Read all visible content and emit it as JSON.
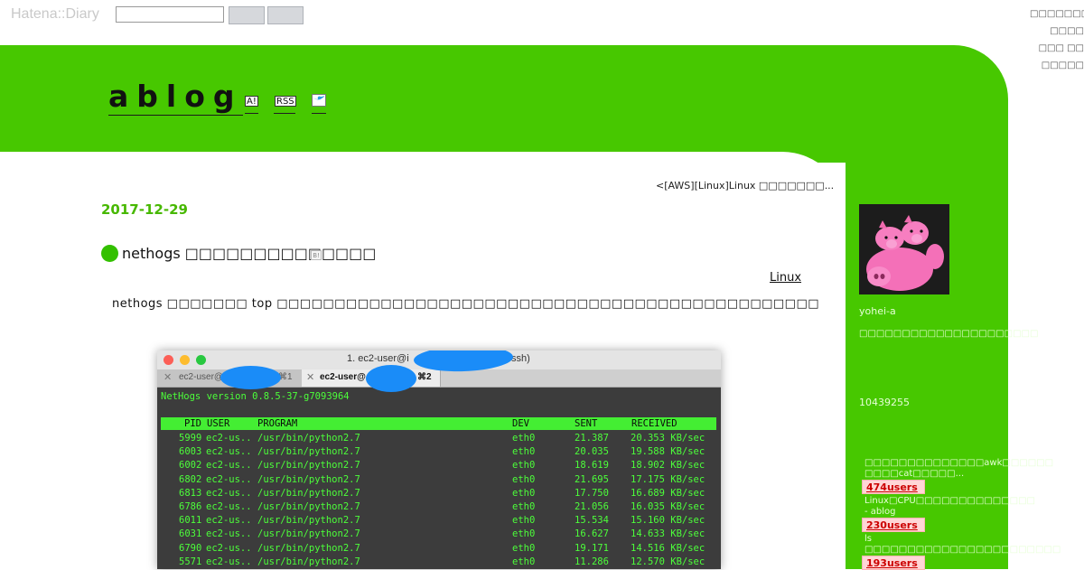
{
  "hatena_bar": {
    "logo": "Hatena::Diary",
    "search_value": "",
    "links": [
      "□□□□□□□",
      "□□□□",
      "□□□ □□",
      "□□□□□"
    ]
  },
  "blog": {
    "title": "ablog",
    "icons": [
      {
        "name": "antenna-icon",
        "label": "A!"
      },
      {
        "name": "rss-icon",
        "label": "RSS"
      },
      {
        "name": "twitter-icon",
        "label": ""
      }
    ]
  },
  "main": {
    "prev_link": "<[AWS][Linux]Linux □□□□□□□...",
    "date": "2017-12-29",
    "post_title": "nethogs □□□□□□□□□□□□□□",
    "category": "Linux",
    "body": "nethogs □□□□□□□ top □□□□□□□□□□□□□□□□□□□□□□□□□□□□□□□□□□□□□□□□□□□□□□□"
  },
  "terminal": {
    "title": "1. ec2-user@i",
    "title_suffix": "ssh)",
    "tab1": {
      "label": "ec2-user@",
      "shortcut": "⌘1"
    },
    "tab2": {
      "label": "ec2-user@",
      "shortcut": "⌘2"
    },
    "version": "NetHogs version 0.8.5-37-g7093964",
    "headers": {
      "pid": "PID",
      "user": "USER",
      "program": "PROGRAM",
      "dev": "DEV",
      "sent": "SENT",
      "received": "RECEIVED"
    },
    "rows": [
      {
        "pid": "5999",
        "user": "ec2-us..",
        "program": "/usr/bin/python2.7",
        "dev": "eth0",
        "sent": "21.387",
        "received": "20.353 KB/sec"
      },
      {
        "pid": "6003",
        "user": "ec2-us..",
        "program": "/usr/bin/python2.7",
        "dev": "eth0",
        "sent": "20.035",
        "received": "19.588 KB/sec"
      },
      {
        "pid": "6002",
        "user": "ec2-us..",
        "program": "/usr/bin/python2.7",
        "dev": "eth0",
        "sent": "18.619",
        "received": "18.902 KB/sec"
      },
      {
        "pid": "6802",
        "user": "ec2-us..",
        "program": "/usr/bin/python2.7",
        "dev": "eth0",
        "sent": "21.695",
        "received": "17.175 KB/sec"
      },
      {
        "pid": "6813",
        "user": "ec2-us..",
        "program": "/usr/bin/python2.7",
        "dev": "eth0",
        "sent": "17.750",
        "received": "16.689 KB/sec"
      },
      {
        "pid": "6786",
        "user": "ec2-us..",
        "program": "/usr/bin/python2.7",
        "dev": "eth0",
        "sent": "21.056",
        "received": "16.035 KB/sec"
      },
      {
        "pid": "6011",
        "user": "ec2-us..",
        "program": "/usr/bin/python2.7",
        "dev": "eth0",
        "sent": "15.534",
        "received": "15.160 KB/sec"
      },
      {
        "pid": "6031",
        "user": "ec2-us..",
        "program": "/usr/bin/python2.7",
        "dev": "eth0",
        "sent": "16.627",
        "received": "14.633 KB/sec"
      },
      {
        "pid": "6790",
        "user": "ec2-us..",
        "program": "/usr/bin/python2.7",
        "dev": "eth0",
        "sent": "19.171",
        "received": "14.516 KB/sec"
      },
      {
        "pid": "5571",
        "user": "ec2-us..",
        "program": "/usr/bin/python2.7",
        "dev": "eth0",
        "sent": "11.286",
        "received": "12.570 KB/sec"
      }
    ]
  },
  "sidebar": {
    "username": "yohei-a",
    "description": "□□□□□□□□□□□□□□□□□□□□□",
    "count": "10439255",
    "hot_entries": [
      {
        "title": "□□□□□□□□□□□□□□awk□□□□□□ □□□□cat□□□□□...",
        "users": "474users"
      },
      {
        "title": "Linux□CPU□□□□□□□□□□□□□□ - ablog",
        "users": "230users"
      },
      {
        "title": "ls □□□□□□□□□□□□□□□□□□□□□□□ - ablog",
        "users": "193users"
      }
    ]
  },
  "colors": {
    "green": "#47c800",
    "terminal_bg": "#3c3c3c",
    "terminal_text": "#4cff3a",
    "redaction": "#1a8cf8"
  }
}
